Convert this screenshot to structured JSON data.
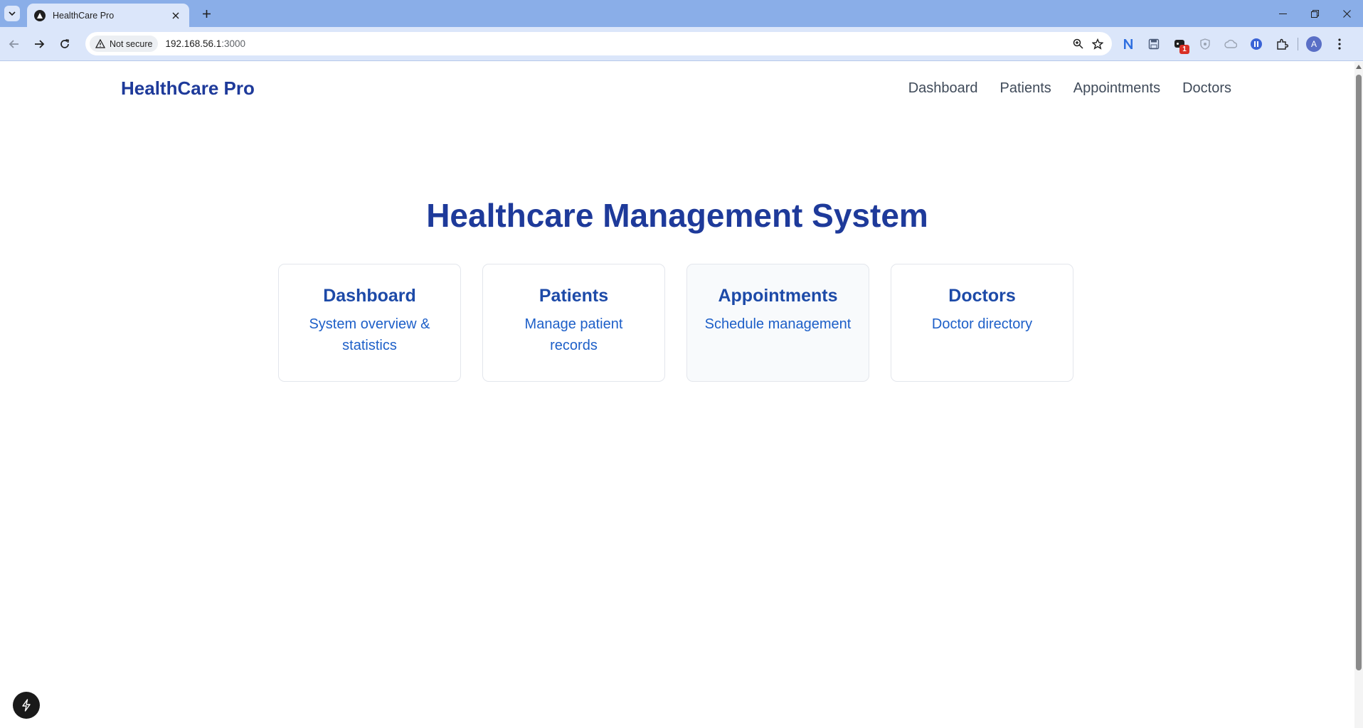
{
  "browser": {
    "tab_title": "HealthCare Pro",
    "security_label": "Not secure",
    "url_host": "192.168.56.1",
    "url_port": ":3000",
    "avatar_initial": "A",
    "extension_badge": "1"
  },
  "site": {
    "brand": "HealthCare Pro",
    "nav": [
      "Dashboard",
      "Patients",
      "Appointments",
      "Doctors"
    ]
  },
  "hero": {
    "title": "Healthcare Management System"
  },
  "cards": [
    {
      "title": "Dashboard",
      "description": "System overview & statistics"
    },
    {
      "title": "Patients",
      "description": "Manage patient records"
    },
    {
      "title": "Appointments",
      "description": "Schedule management"
    },
    {
      "title": "Doctors",
      "description": "Doctor directory"
    }
  ],
  "colors": {
    "brand": "#1e3a9a",
    "card_title": "#1d4aa8",
    "card_desc": "#1d5fc8",
    "tabstrip": "#8aaee8"
  }
}
